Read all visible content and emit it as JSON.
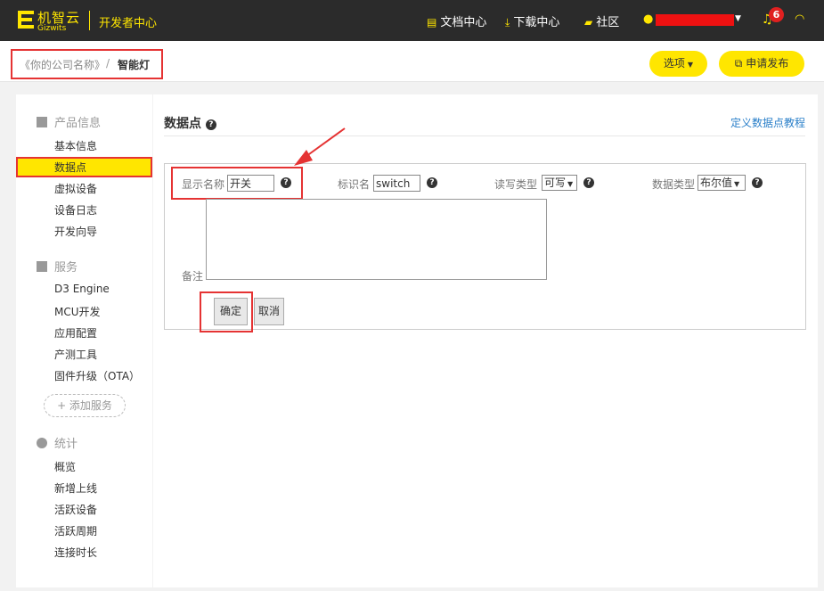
{
  "header": {
    "logo_cn": "机智云",
    "logo_en": "Gizwits",
    "dev_center": "开发者中心",
    "nav": [
      {
        "label": "文档中心",
        "icon": "document-icon"
      },
      {
        "label": "下载中心",
        "icon": "download-icon"
      },
      {
        "label": "社区",
        "icon": "chat-icon"
      }
    ],
    "notification_count": "6"
  },
  "breadcrumb": {
    "company": "《你的公司名称》",
    "separator": "/",
    "product": "智能灯"
  },
  "toolbar": {
    "options_label": "选项",
    "publish_label": "申请发布"
  },
  "sidebar": {
    "groups": [
      {
        "title": "产品信息",
        "items": [
          "基本信息",
          "数据点",
          "虚拟设备",
          "设备日志",
          "开发向导"
        ]
      },
      {
        "title": "服务",
        "items": [
          "D3 Engine",
          "MCU开发",
          "应用配置",
          "产测工具",
          "固件升级（OTA）"
        ]
      },
      {
        "title": "统计",
        "items": [
          "概览",
          "新增上线",
          "活跃设备",
          "活跃周期",
          "连接时长"
        ]
      }
    ],
    "add_service": "+ 添加服务",
    "active_item": "数据点"
  },
  "main": {
    "title": "数据点",
    "tutorial_link": "定义数据点教程",
    "form": {
      "display_name_label": "显示名称",
      "display_name_value": "开关",
      "identifier_label": "标识名",
      "identifier_value": "switch",
      "rw_label": "读写类型",
      "rw_value": "可写",
      "data_type_label": "数据类型",
      "data_type_value": "布尔值",
      "remark_label": "备注",
      "confirm_label": "确定",
      "cancel_label": "取消"
    }
  },
  "colors": {
    "accent_yellow": "#ffe600",
    "annotation_red": "#e53333",
    "topbar_bg": "#2b2b2b",
    "link_blue": "#2a7fc9"
  }
}
